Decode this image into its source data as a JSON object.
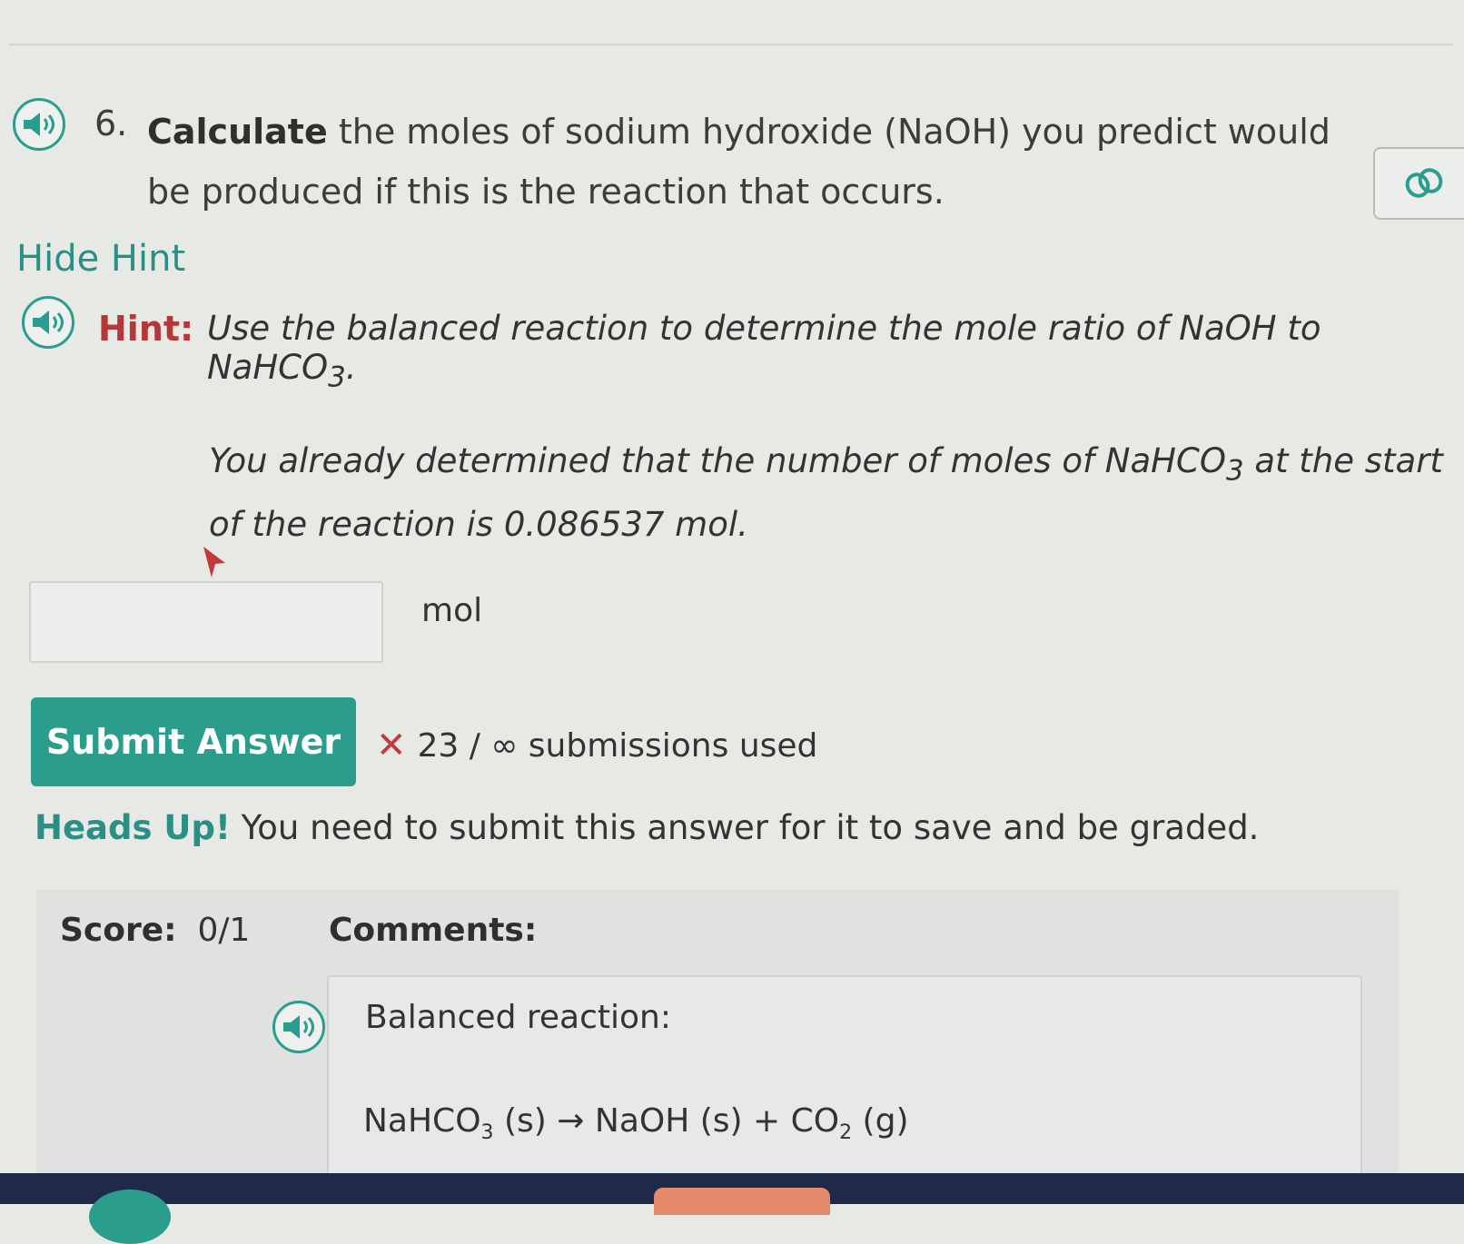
{
  "question": {
    "number": "6.",
    "bold_word": "Calculate",
    "text": " the moles of sodium hydroxide (NaOH) you predict would be produced if this is the reaction that occurs."
  },
  "hint": {
    "toggle_label": "Hide Hint",
    "label": "Hint:",
    "text_prefix": "Use the balanced reaction to determine the mole ratio of NaOH to NaHCO",
    "text_sub": "3",
    "text_suffix": ".",
    "text2_prefix": "You already determined that the number of moles of NaHCO",
    "text2_sub": "3",
    "text2_suffix": " at the start of the reaction is 0.086537 mol."
  },
  "answer": {
    "value": "",
    "unit": "mol"
  },
  "submit": {
    "label": "Submit Answer",
    "count_text": "23 / ∞ submissions used"
  },
  "heads_up": {
    "bold": "Heads Up!",
    "text": " You need to submit this answer for it to save and be graded."
  },
  "score": {
    "label": "Score:",
    "value": "0/1",
    "comments_label": "Comments:",
    "comment_title": "Balanced reaction:",
    "reaction": {
      "reactant": "NaHCO",
      "reactant_sub": "3",
      "reactant_state": " (s) ",
      "arrow": "→",
      "product1": " NaOH (s)  + CO",
      "product2_sub": "2",
      "product2_state": " (g)"
    }
  },
  "colors": {
    "accent": "#2a9d8d",
    "hint_red": "#b2383a",
    "error_red": "#c43a3a"
  }
}
